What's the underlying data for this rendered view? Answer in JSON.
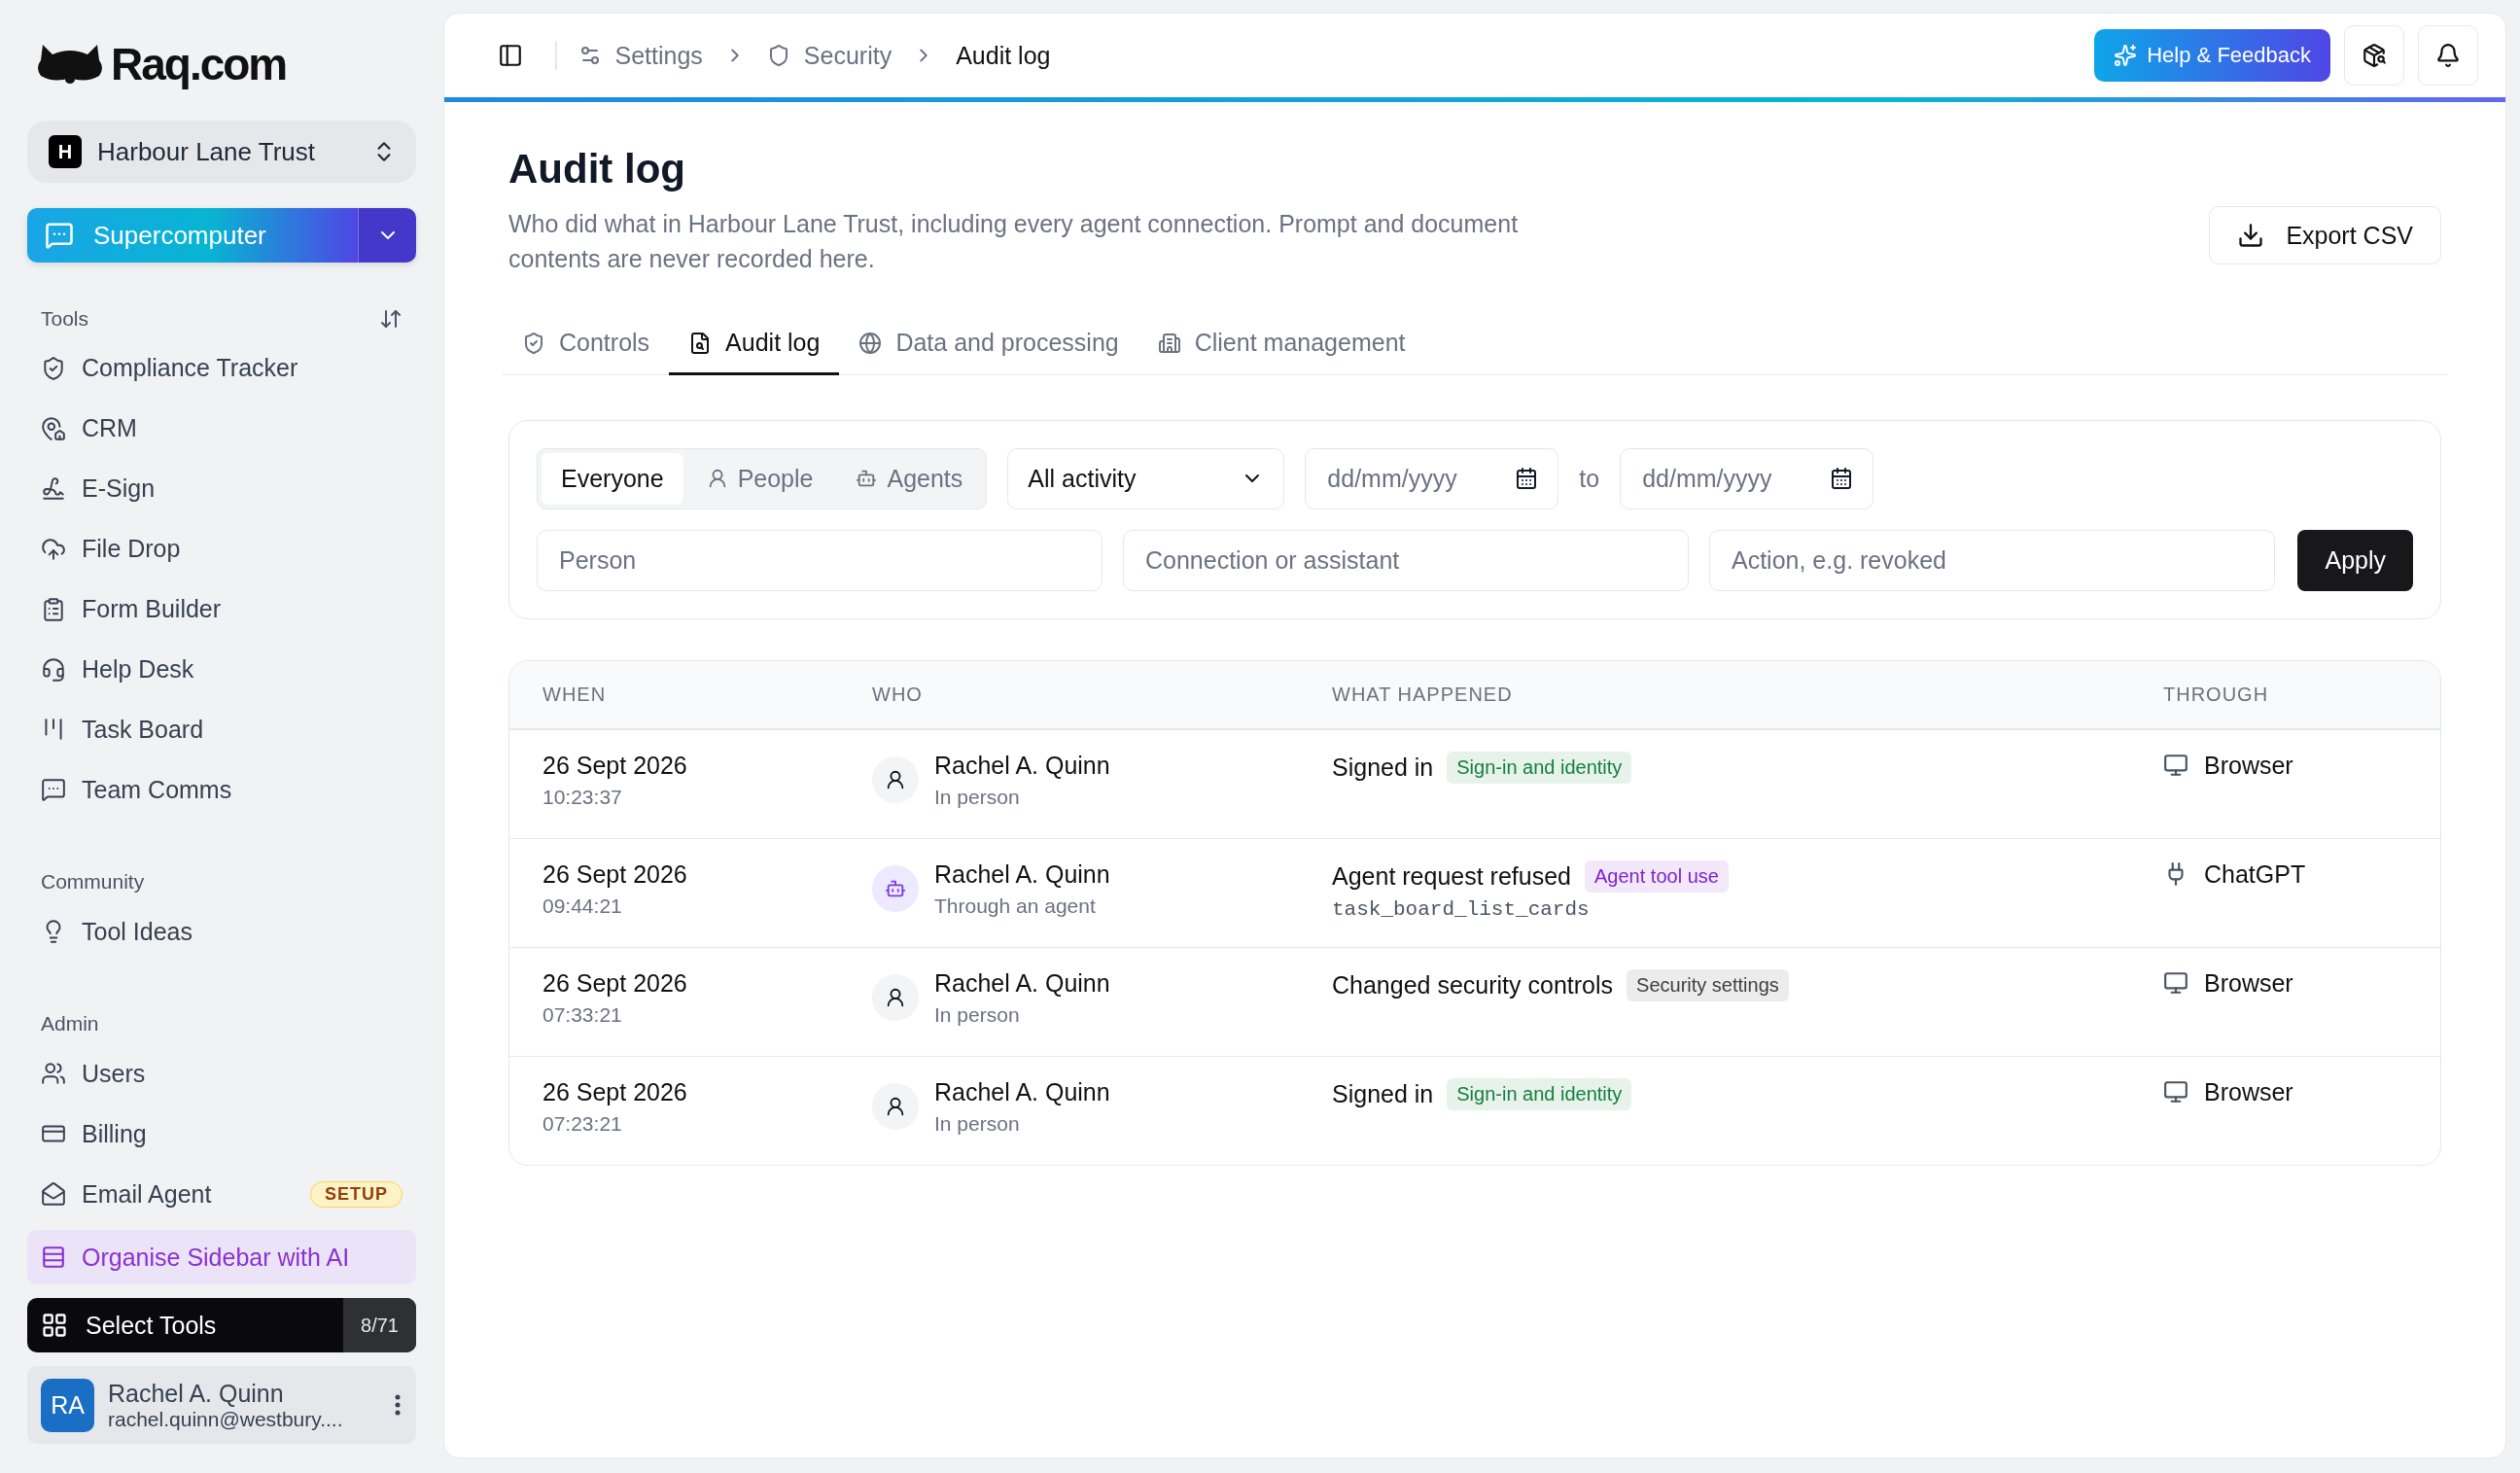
{
  "brand": {
    "name": "Raq.com"
  },
  "workspace": {
    "initial": "H",
    "name": "Harbour Lane Trust"
  },
  "primary_button": {
    "label": "Supercomputer"
  },
  "sidebar": {
    "sections": [
      {
        "title": "Tools",
        "items": [
          {
            "label": "Compliance Tracker"
          },
          {
            "label": "CRM"
          },
          {
            "label": "E-Sign"
          },
          {
            "label": "File Drop"
          },
          {
            "label": "Form Builder"
          },
          {
            "label": "Help Desk"
          },
          {
            "label": "Task Board"
          },
          {
            "label": "Team Comms"
          }
        ]
      },
      {
        "title": "Community",
        "items": [
          {
            "label": "Tool Ideas"
          }
        ]
      },
      {
        "title": "Admin",
        "items": [
          {
            "label": "Users"
          },
          {
            "label": "Billing"
          },
          {
            "label": "Email Agent",
            "badge": "SETUP"
          }
        ]
      }
    ]
  },
  "organise_button": {
    "label": "Organise Sidebar with AI"
  },
  "select_tools": {
    "label": "Select Tools",
    "count": "8/71"
  },
  "user": {
    "initials": "RA",
    "name": "Rachel A. Quinn",
    "email": "rachel.quinn@westbury...."
  },
  "breadcrumbs": [
    {
      "label": "Settings"
    },
    {
      "label": "Security"
    },
    {
      "label": "Audit log"
    }
  ],
  "help_button": {
    "label": "Help & Feedback"
  },
  "page": {
    "title": "Audit log",
    "description": "Who did what in Harbour Lane Trust, including every agent connection. Prompt and document contents are never recorded here.",
    "export_button": "Export CSV"
  },
  "tabs": [
    {
      "label": "Controls",
      "selected": false
    },
    {
      "label": "Audit log",
      "selected": true
    },
    {
      "label": "Data and processing",
      "selected": false
    },
    {
      "label": "Client management",
      "selected": false
    }
  ],
  "filters": {
    "segments": [
      {
        "label": "Everyone",
        "selected": true
      },
      {
        "label": "People",
        "selected": false
      },
      {
        "label": "Agents",
        "selected": false
      }
    ],
    "activity": "All activity",
    "date_from": {
      "placeholder": "dd/mm/yyyy"
    },
    "date_separator": "to",
    "date_to": {
      "placeholder": "dd/mm/yyyy"
    },
    "person": {
      "placeholder": "Person"
    },
    "connection": {
      "placeholder": "Connection or assistant"
    },
    "action": {
      "placeholder": "Action, e.g. revoked"
    },
    "apply": "Apply"
  },
  "table": {
    "columns": [
      "WHEN",
      "WHO",
      "WHAT HAPPENED",
      "THROUGH"
    ],
    "rows": [
      {
        "date": "26 Sept 2026",
        "time": "10:23:37",
        "who": {
          "kind": "person",
          "name": "Rachel A. Quinn",
          "via": "In person"
        },
        "event": "Signed in",
        "tag": {
          "label": "Sign-in and identity",
          "color": "#15803d"
        },
        "through": {
          "kind": "browser",
          "label": "Browser"
        }
      },
      {
        "date": "26 Sept 2026",
        "time": "09:44:21",
        "who": {
          "kind": "agent",
          "name": "Rachel A. Quinn",
          "via": "Through an agent"
        },
        "event": "Agent request refused",
        "tag": {
          "label": "Agent tool use",
          "color": "#7e22ce"
        },
        "detail": "task_board_list_cards",
        "through": {
          "kind": "connector",
          "label": "ChatGPT"
        }
      },
      {
        "date": "26 Sept 2026",
        "time": "07:33:21",
        "who": {
          "kind": "person",
          "name": "Rachel A. Quinn",
          "via": "In person"
        },
        "event": "Changed security controls",
        "tag": {
          "label": "Security settings",
          "color": "#404040"
        },
        "through": {
          "kind": "browser",
          "label": "Browser"
        }
      },
      {
        "date": "26 Sept 2026",
        "time": "07:23:21",
        "who": {
          "kind": "person",
          "name": "Rachel A. Quinn",
          "via": "In person"
        },
        "event": "Signed in",
        "tag": {
          "label": "Sign-in and identity",
          "color": "#15803d"
        },
        "through": {
          "kind": "browser",
          "label": "Browser"
        }
      }
    ]
  }
}
